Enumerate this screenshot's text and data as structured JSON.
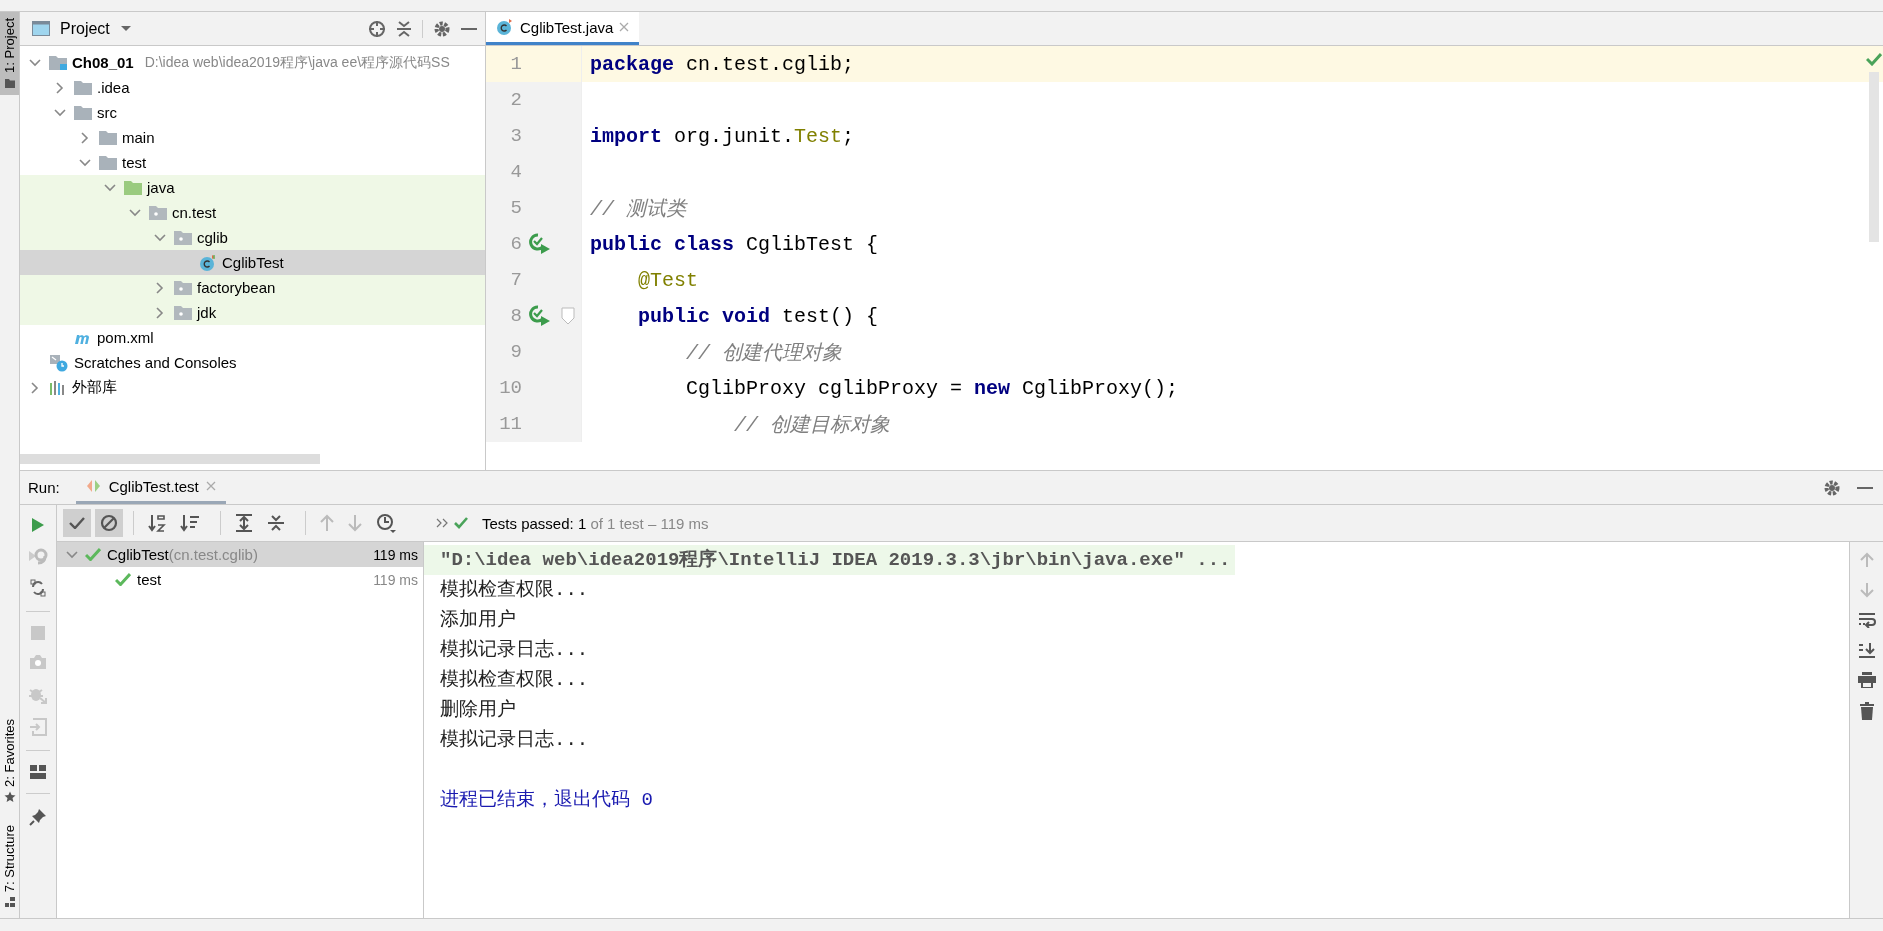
{
  "side_tabs": [
    {
      "label": "1: Project",
      "selected": true,
      "kind": "project"
    },
    {
      "label": "2: Favorites",
      "selected": false,
      "kind": "favorites"
    },
    {
      "label": "7: Structure",
      "selected": false,
      "kind": "structure"
    }
  ],
  "project": {
    "title": "Project",
    "tree": [
      {
        "label": "Ch08_01",
        "path": "D:\\idea web\\idea2019程序\\java ee\\程序源代码SS",
        "kind": "module",
        "expanded": true,
        "tinted": false,
        "selected": false,
        "children": [
          {
            "label": ".idea",
            "kind": "folder",
            "expanded": false,
            "tinted": false,
            "selected": false
          },
          {
            "label": "src",
            "kind": "folder",
            "expanded": true,
            "tinted": false,
            "selected": false,
            "children": [
              {
                "label": "main",
                "kind": "folder",
                "expanded": false,
                "tinted": false,
                "selected": false
              },
              {
                "label": "test",
                "kind": "folder",
                "expanded": true,
                "tinted": false,
                "selected": false,
                "children": [
                  {
                    "label": "java",
                    "kind": "test-root",
                    "expanded": true,
                    "tinted": true,
                    "selected": false,
                    "children": [
                      {
                        "label": "cn.test",
                        "kind": "package",
                        "expanded": true,
                        "tinted": true,
                        "selected": false,
                        "children": [
                          {
                            "label": "cglib",
                            "kind": "package",
                            "expanded": true,
                            "tinted": true,
                            "selected": false,
                            "children": [
                              {
                                "label": "CglibTest",
                                "kind": "class",
                                "tinted": true,
                                "selected": true
                              }
                            ]
                          },
                          {
                            "label": "factorybean",
                            "kind": "package",
                            "expanded": false,
                            "tinted": true,
                            "selected": false
                          },
                          {
                            "label": "jdk",
                            "kind": "package",
                            "expanded": false,
                            "tinted": true,
                            "selected": false
                          }
                        ]
                      }
                    ]
                  }
                ]
              }
            ]
          },
          {
            "label": "pom.xml",
            "kind": "maven",
            "tinted": false,
            "selected": false
          }
        ]
      },
      {
        "label": "Scratches and Consoles",
        "kind": "scratches",
        "tinted": false,
        "selected": false
      },
      {
        "label": "外部库",
        "kind": "library",
        "expanded": false,
        "tinted": false,
        "selected": false
      }
    ]
  },
  "editor": {
    "tabs": [
      {
        "label": "CglibTest.java",
        "selected": true
      }
    ],
    "lines": [
      {
        "number": "1",
        "current": true,
        "run": false,
        "fold": false,
        "tokens": [
          {
            "kind": "keyword",
            "text": "package"
          },
          {
            "kind": "plain",
            "text": " cn.test.cglib;"
          }
        ]
      },
      {
        "number": "2",
        "current": false,
        "run": false,
        "fold": false
      },
      {
        "number": "3",
        "current": false,
        "run": false,
        "fold": false,
        "tokens": [
          {
            "kind": "keyword",
            "text": "import"
          },
          {
            "kind": "plain",
            "text": " org.junit."
          },
          {
            "kind": "annotation",
            "text": "Test"
          },
          {
            "kind": "plain",
            "text": ";"
          }
        ]
      },
      {
        "number": "4",
        "current": false,
        "run": false,
        "fold": false
      },
      {
        "number": "5",
        "current": false,
        "run": false,
        "fold": false,
        "tokens": [
          {
            "kind": "comment",
            "text": "// 测试类"
          }
        ]
      },
      {
        "number": "6",
        "current": false,
        "run": true,
        "fold": false,
        "tokens": [
          {
            "kind": "keyword",
            "text": "public class"
          },
          {
            "kind": "plain",
            "text": " CglibTest {"
          }
        ]
      },
      {
        "number": "7",
        "current": false,
        "run": false,
        "fold": false,
        "tokens": [
          {
            "kind": "annotation",
            "text": "    @Test"
          }
        ]
      },
      {
        "number": "8",
        "current": false,
        "run": true,
        "fold": true,
        "tokens": [
          {
            "kind": "keyword",
            "text": "    public void"
          },
          {
            "kind": "plain",
            "text": " test() {"
          }
        ]
      },
      {
        "number": "9",
        "current": false,
        "run": false,
        "fold": false,
        "tokens": [
          {
            "kind": "comment",
            "text": "        // 创建代理对象"
          }
        ]
      },
      {
        "number": "10",
        "current": false,
        "run": false,
        "fold": false,
        "tokens": [
          {
            "kind": "plain",
            "text": "        CglibProxy cglibProxy = "
          },
          {
            "kind": "keyword",
            "text": "new"
          },
          {
            "kind": "plain",
            "text": " CglibProxy();"
          }
        ]
      },
      {
        "number": "11",
        "current": false,
        "run": false,
        "fold": false,
        "tokens": [
          {
            "kind": "comment",
            "text": "            // 创建目标对象"
          }
        ]
      }
    ]
  },
  "run": {
    "title": "Run:",
    "tabs": [
      {
        "label": "CglibTest.test",
        "selected": true
      }
    ],
    "show_passed": true,
    "show_ignored": true,
    "status": {
      "passed": true,
      "label": "Tests passed: 1",
      "detail": "of 1 test – 119 ms"
    },
    "tests": [
      {
        "name": "CglibTest",
        "package": "(cn.test.cglib)",
        "time": "119 ms",
        "passed": true,
        "selected": true,
        "expanded": true,
        "children": [
          {
            "name": "test",
            "time": "119 ms",
            "passed": true,
            "selected": false
          }
        ]
      }
    ],
    "console": [
      {
        "kind": "command",
        "text": "\"D:\\idea web\\idea2019程序\\IntelliJ IDEA 2019.3.3\\jbr\\bin\\java.exe\" ..."
      },
      {
        "kind": "output",
        "text": "模拟检查权限..."
      },
      {
        "kind": "output",
        "text": "添加用户"
      },
      {
        "kind": "output",
        "text": "模拟记录日志..."
      },
      {
        "kind": "output",
        "text": "模拟检查权限..."
      },
      {
        "kind": "output",
        "text": "删除用户"
      },
      {
        "kind": "output",
        "text": "模拟记录日志..."
      },
      {
        "kind": "exit",
        "text": "进程已结束，退出代码 0"
      }
    ]
  }
}
